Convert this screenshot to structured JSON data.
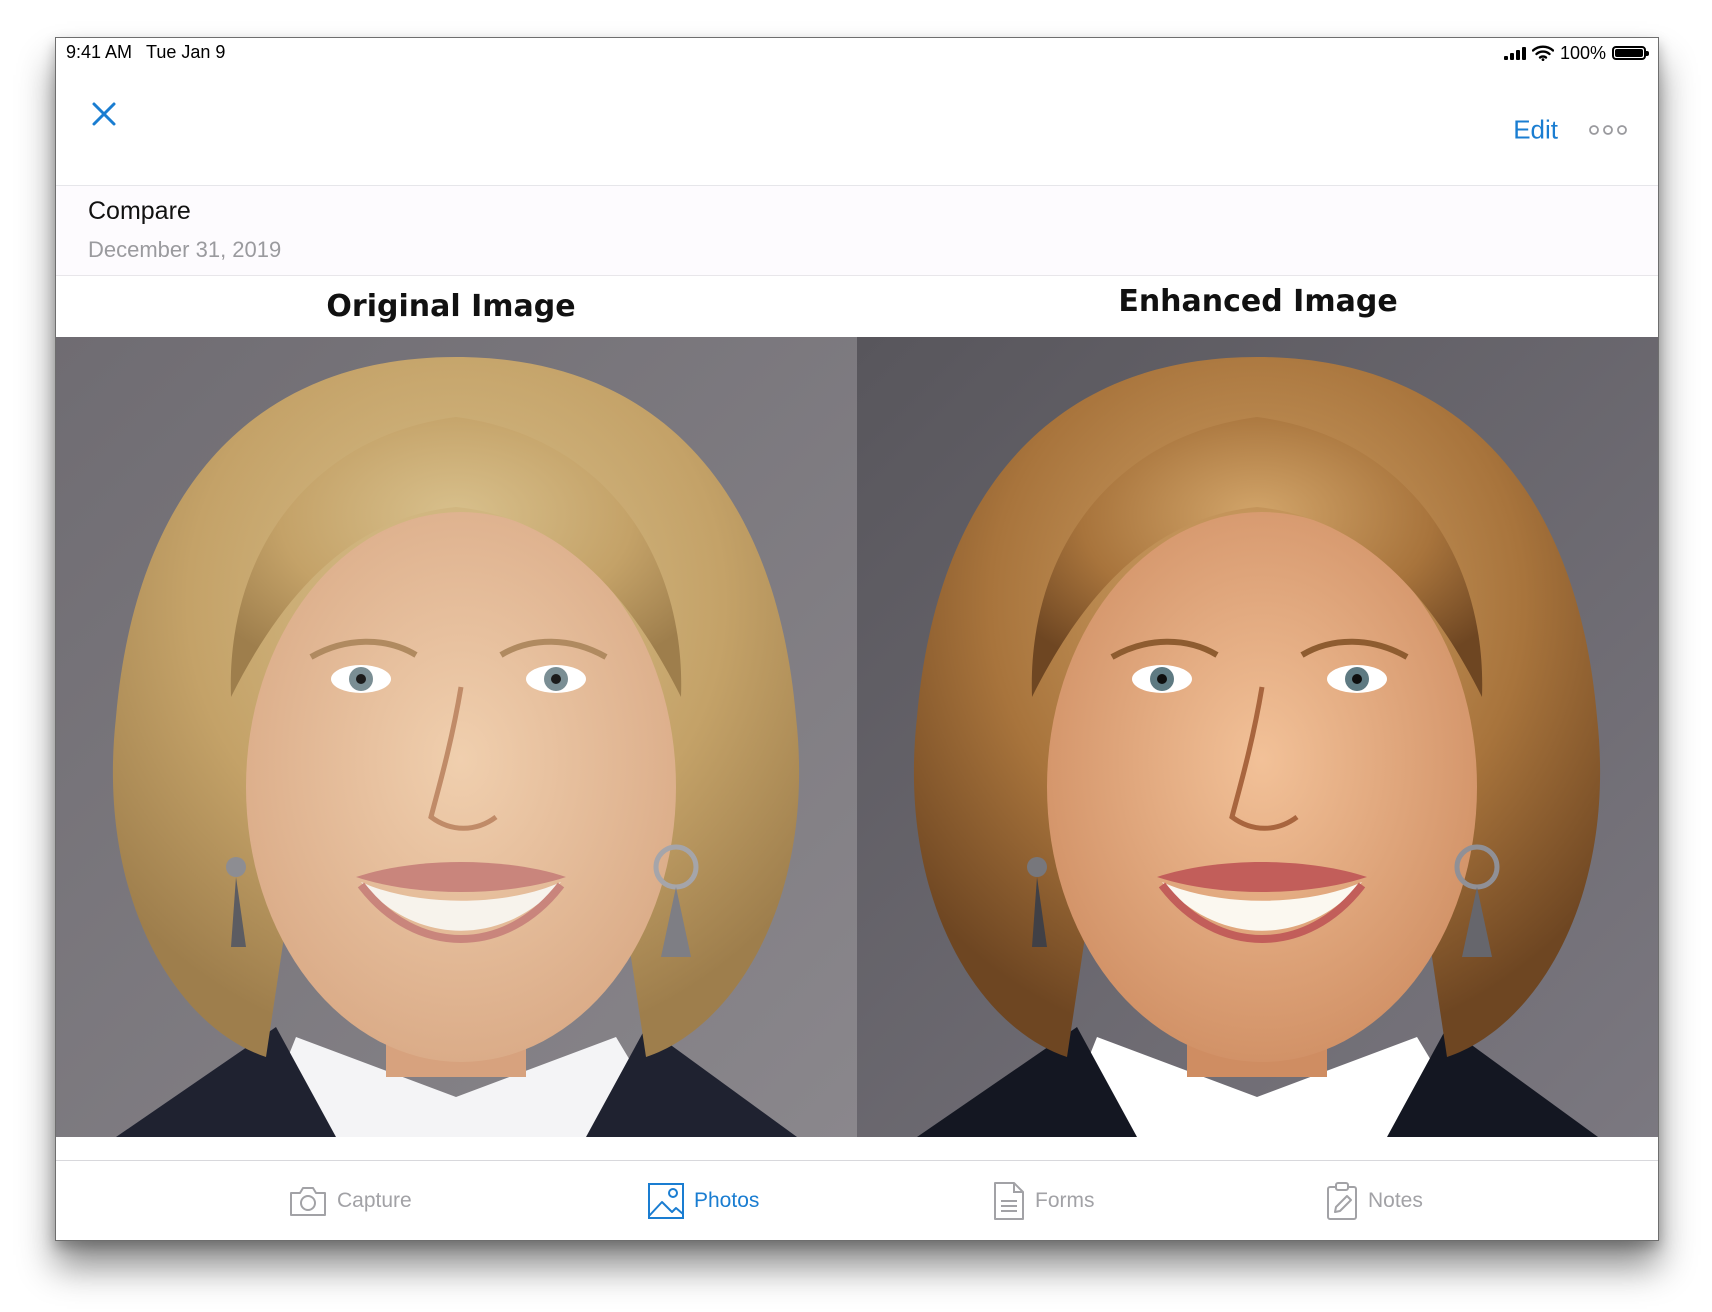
{
  "status_bar": {
    "time": "9:41 AM",
    "date": "Tue Jan 9",
    "battery_text": "100%",
    "battery_level": 1.0
  },
  "nav": {
    "close_icon": "close-icon",
    "edit_label": "Edit",
    "more_icon": "more-icon"
  },
  "header": {
    "title": "Compare",
    "date": "December 31, 2019"
  },
  "compare": {
    "left_label": "Original Image",
    "right_label": "Enhanced Image"
  },
  "tabs": [
    {
      "label": "Capture",
      "icon": "camera-icon",
      "active": false
    },
    {
      "label": "Photos",
      "icon": "photo-icon",
      "active": true
    },
    {
      "label": "Forms",
      "icon": "document-icon",
      "active": false
    },
    {
      "label": "Notes",
      "icon": "clipboard-icon",
      "active": false
    }
  ],
  "colors": {
    "accent": "#1a7dd1",
    "inactive": "#a2a2a6"
  }
}
